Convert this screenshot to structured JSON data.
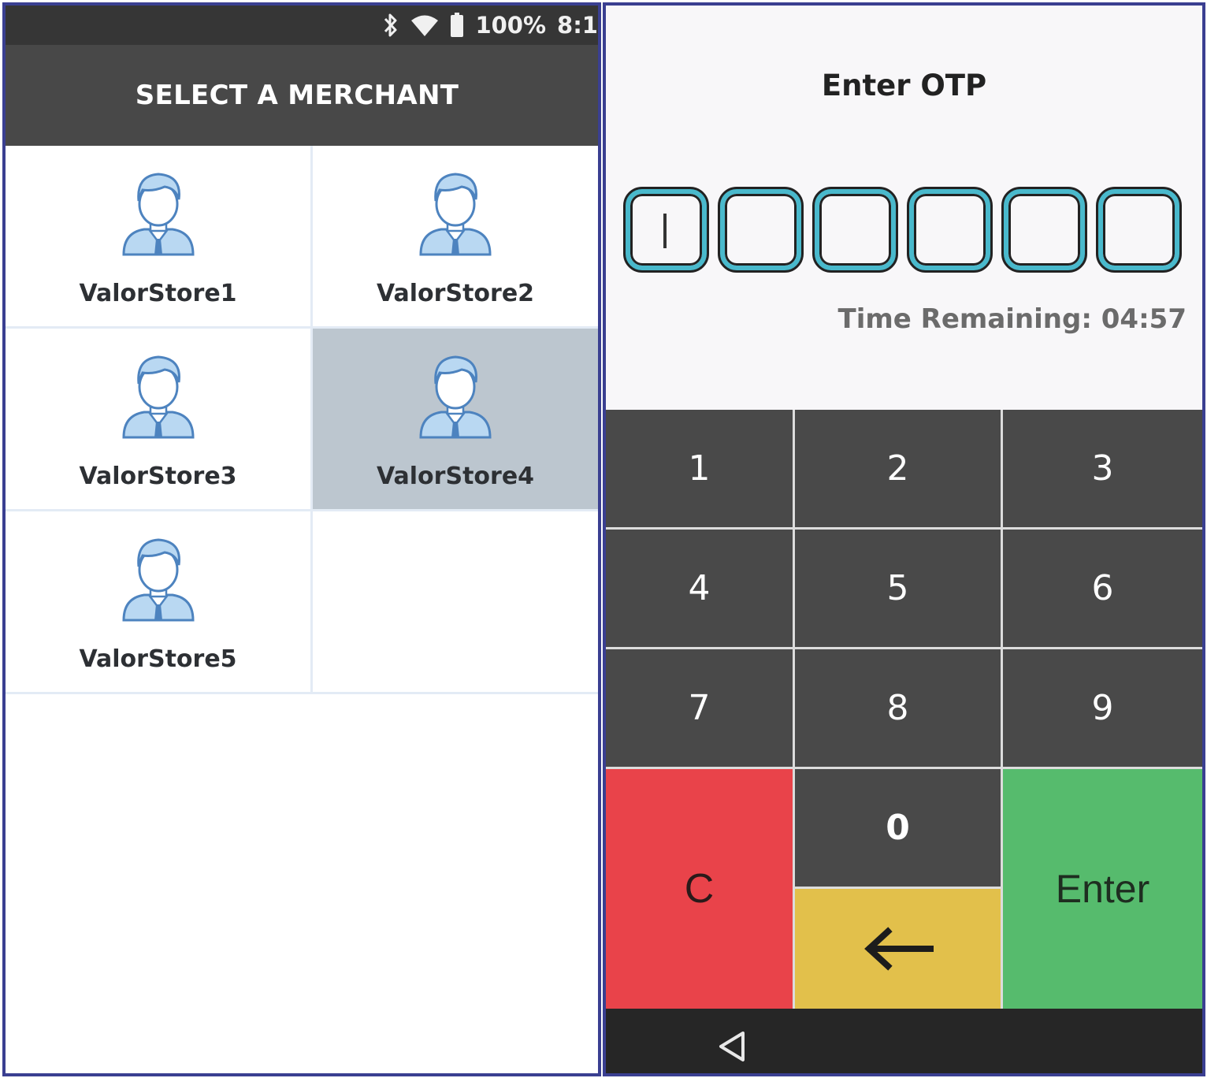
{
  "left_screen": {
    "status_bar": {
      "battery_text": "100%",
      "time_text": "8:1"
    },
    "header": {
      "title": "SELECT A MERCHANT"
    },
    "merchants": [
      {
        "name": "ValorStore1",
        "selected": false
      },
      {
        "name": "ValorStore2",
        "selected": false
      },
      {
        "name": "ValorStore3",
        "selected": false
      },
      {
        "name": "ValorStore4",
        "selected": true
      },
      {
        "name": "ValorStore5",
        "selected": false
      }
    ]
  },
  "right_screen": {
    "title": "Enter OTP",
    "otp": {
      "digits": [
        "",
        "",
        "",
        "",
        "",
        ""
      ]
    },
    "timer": "Time Remaining: 04:57",
    "keypad": {
      "k1": "1",
      "k2": "2",
      "k3": "3",
      "k4": "4",
      "k5": "5",
      "k6": "6",
      "k7": "7",
      "k8": "8",
      "k9": "9",
      "k0": "0",
      "clear": "C",
      "enter": "Enter",
      "backspace_icon": "arrow-left-icon"
    },
    "nav": {
      "back_icon": "triangle-back-icon"
    }
  },
  "colors": {
    "frame_border": "#3a3f91",
    "header_bg": "#484848",
    "selected_cell": "#bcc6cf",
    "otp_box_border": "#49b9cc",
    "key_dark": "#494949",
    "key_clear": "#e9434a",
    "key_backspace": "#e2c04b",
    "key_enter": "#56bb6d",
    "avatar_blue": "#b9d8f2",
    "avatar_outline": "#4d83bf"
  }
}
